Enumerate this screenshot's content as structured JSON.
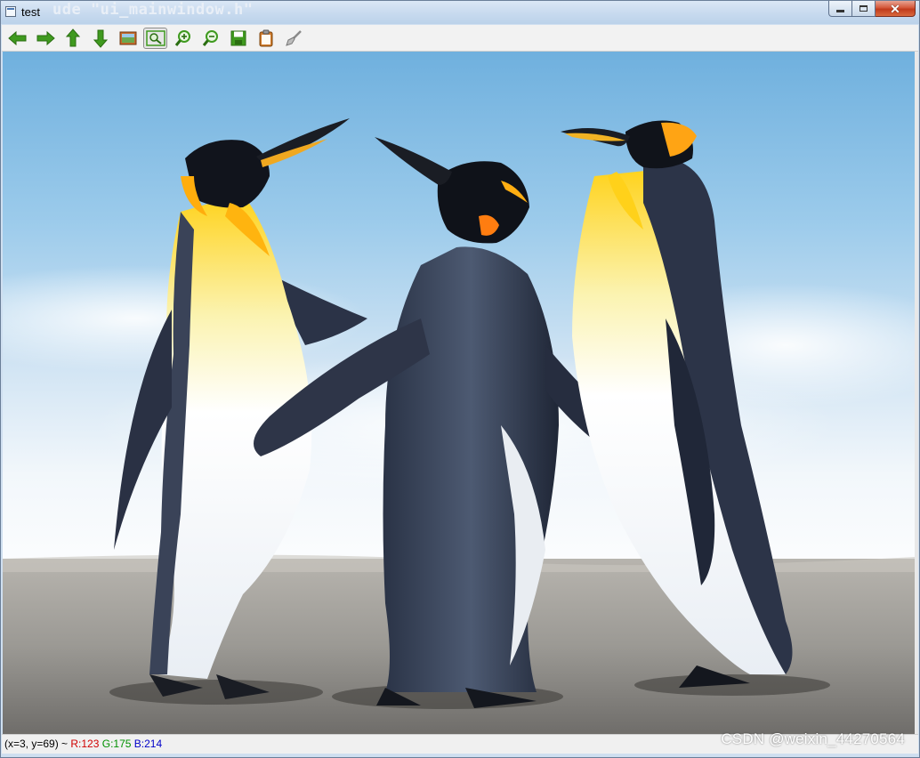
{
  "window": {
    "title": "test",
    "background_code_text": "ude \"ui_mainwindow.h\""
  },
  "toolbar": {
    "buttons": [
      {
        "name": "pan-left",
        "icon": "arrow-left-icon"
      },
      {
        "name": "pan-right",
        "icon": "arrow-right-icon"
      },
      {
        "name": "pan-up",
        "icon": "arrow-up-icon"
      },
      {
        "name": "pan-down",
        "icon": "arrow-down-icon"
      },
      {
        "name": "fit-image",
        "icon": "image-icon"
      },
      {
        "name": "zoom-select",
        "icon": "zoom-rect-icon",
        "active": true
      },
      {
        "name": "zoom-in",
        "icon": "zoom-in-icon"
      },
      {
        "name": "zoom-out",
        "icon": "zoom-out-icon"
      },
      {
        "name": "save",
        "icon": "floppy-icon"
      },
      {
        "name": "copy",
        "icon": "clipboard-icon"
      },
      {
        "name": "properties",
        "icon": "brush-icon"
      }
    ]
  },
  "image": {
    "subject": "three emperor penguins on a beach"
  },
  "status": {
    "coords": "(x=3, y=69) ~ ",
    "r": "R:123",
    "g": "G:175",
    "b": "B:214"
  },
  "watermark": "CSDN @weixin_44270564",
  "colors": {
    "toolbar_icon_green": "#3f9a1f",
    "status_r": "#d00000",
    "status_g": "#009000",
    "status_b": "#0000c8"
  }
}
